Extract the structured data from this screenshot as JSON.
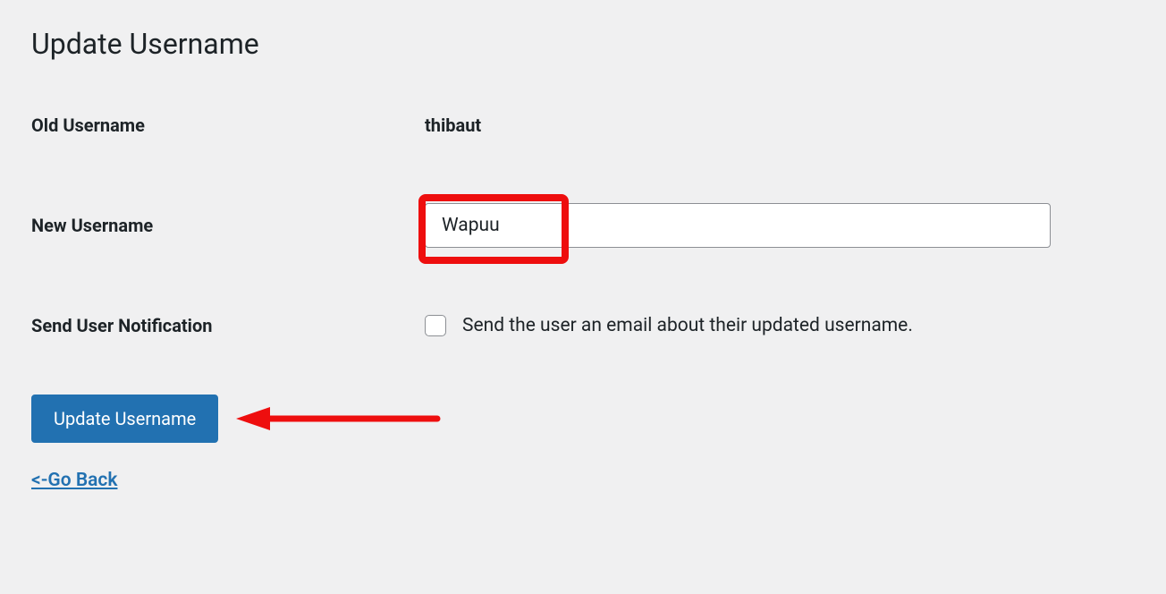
{
  "page": {
    "title": "Update Username"
  },
  "form": {
    "old_username_label": "Old Username",
    "old_username_value": "thibaut",
    "new_username_label": "New Username",
    "new_username_value": "Wapuu",
    "notification_label": "Send User Notification",
    "notification_checkbox_label": "Send the user an email about their updated username.",
    "submit_label": "Update Username",
    "go_back_label": "<-Go Back"
  }
}
